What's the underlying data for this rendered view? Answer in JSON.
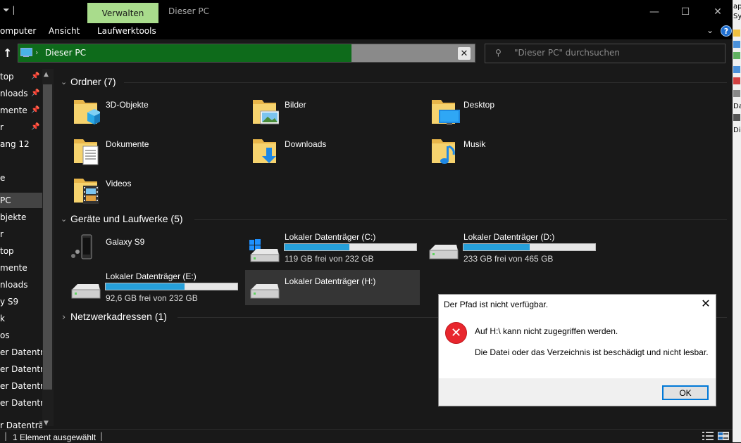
{
  "titlebar": {
    "left_glyphs": "⏷ |",
    "manage_tab": "Verwalten",
    "title": "Dieser PC",
    "minimize": "—",
    "maximize": "☐",
    "close": "✕"
  },
  "ribbon": {
    "tabs": [
      "omputer",
      "Ansicht",
      "Laufwerktools"
    ],
    "collapse_glyph": "⌄",
    "help": "?"
  },
  "address": {
    "up": "↑",
    "separator": "›",
    "path": "Dieser PC",
    "clear": "✕",
    "progress_fraction": 0.73
  },
  "search": {
    "icon": "⚲",
    "placeholder": "\"Dieser PC\" durchsuchen"
  },
  "sidebar": {
    "items": [
      {
        "label": "top",
        "pinned": true
      },
      {
        "label": "nloads",
        "pinned": true
      },
      {
        "label": "mente",
        "pinned": true
      },
      {
        "label": "r",
        "pinned": true
      },
      {
        "label": "ang 12",
        "pinned": false
      },
      {
        "label": "",
        "pinned": false
      },
      {
        "label": "e",
        "pinned": false
      },
      {
        "label": "PC",
        "pinned": false,
        "selected": true
      },
      {
        "label": "bjekte",
        "pinned": false
      },
      {
        "label": "r",
        "pinned": false
      },
      {
        "label": "top",
        "pinned": false
      },
      {
        "label": "mente",
        "pinned": false
      },
      {
        "label": "nloads",
        "pinned": false
      },
      {
        "label": "y S9",
        "pinned": false
      },
      {
        "label": "k",
        "pinned": false
      },
      {
        "label": "os",
        "pinned": false
      },
      {
        "label": "er Datenträ",
        "pinned": false
      },
      {
        "label": "er Datenträ",
        "pinned": false
      },
      {
        "label": "er Datenträ",
        "pinned": false
      },
      {
        "label": "er Datenträ",
        "pinned": false
      },
      {
        "label": "",
        "pinned": false
      },
      {
        "label": "r Datenträg",
        "pinned": false
      }
    ],
    "pin_glyph": "📌"
  },
  "groups": {
    "folders": {
      "header": "Ordner (7)",
      "items": [
        "3D-Objekte",
        "Bilder",
        "Desktop",
        "Dokumente",
        "Downloads",
        "Musik",
        "Videos"
      ]
    },
    "devices": {
      "header": "Geräte und Laufwerke (5)",
      "phone": "Galaxy S9",
      "drives": [
        {
          "name": "Lokaler Datenträger (C:)",
          "free": "119 GB frei von 232 GB",
          "used_fraction": 0.49
        },
        {
          "name": "Lokaler Datenträger (D:)",
          "free": "233 GB frei von 465 GB",
          "used_fraction": 0.5
        },
        {
          "name": "Lokaler Datenträger (E:)",
          "free": "92,6 GB frei von 232 GB",
          "used_fraction": 0.6
        },
        {
          "name": "Lokaler Datenträger (H:)",
          "free": "",
          "used_fraction": null
        }
      ]
    },
    "network": {
      "header": "Netzwerkadressen (1)"
    }
  },
  "statusbar": {
    "text": "1 Element ausgewählt",
    "sep": "|"
  },
  "dialog": {
    "title": "Der Pfad ist nicht verfügbar.",
    "close": "✕",
    "message1": "Auf H:\\ kann nicht zugegriffen werden.",
    "message2": "Die Datei oder das Verzeichnis ist beschädigt und nicht lesbar.",
    "ok": "OK",
    "error_glyph": "✕"
  },
  "right_strip": {
    "labels": [
      "ap",
      "Sy",
      "Da",
      "Di"
    ]
  },
  "colors": {
    "accent": "#0078d7",
    "drive_fill": "#26a0da",
    "manage_tab": "#a9dc8c",
    "address_progress": "#0e6b1b",
    "error": "#e8262d"
  }
}
